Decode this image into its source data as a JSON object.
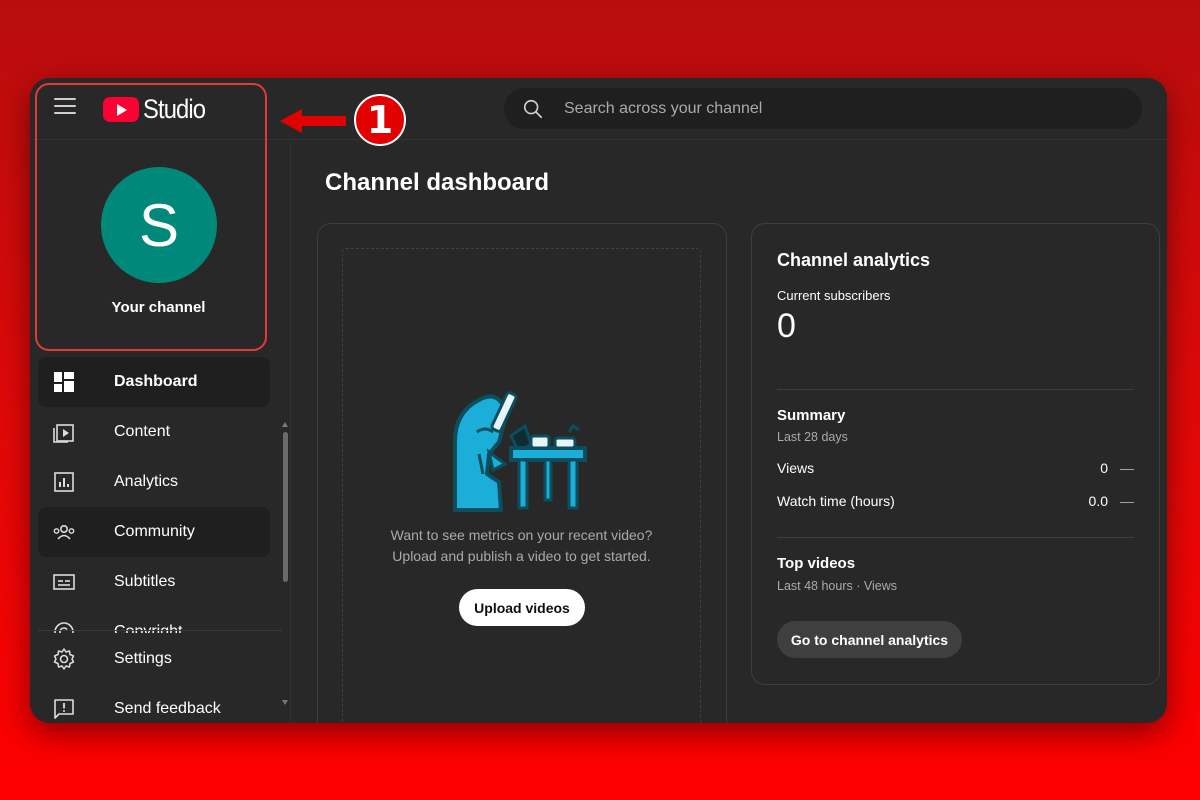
{
  "brand": {
    "logo_text": "Studio",
    "accent": "#ff0033"
  },
  "search": {
    "placeholder": "Search across your channel"
  },
  "channel": {
    "avatar_letter": "S",
    "avatar_color": "#00897b",
    "label": "Your channel"
  },
  "sidebar": {
    "items": [
      {
        "label": "Dashboard",
        "icon": "dashboard-icon",
        "state": "active"
      },
      {
        "label": "Content",
        "icon": "content-icon"
      },
      {
        "label": "Analytics",
        "icon": "analytics-icon"
      },
      {
        "label": "Community",
        "icon": "community-icon",
        "state": "hover"
      },
      {
        "label": "Subtitles",
        "icon": "subtitles-icon"
      },
      {
        "label": "Copyright",
        "icon": "copyright-icon"
      }
    ],
    "bottom": [
      {
        "label": "Settings",
        "icon": "gear-icon"
      },
      {
        "label": "Send feedback",
        "icon": "feedback-icon"
      }
    ]
  },
  "annotation": {
    "step": "1",
    "color": "#e53935"
  },
  "main": {
    "title": "Channel dashboard",
    "upload_card": {
      "prompt_line1": "Want to see metrics on your recent video?",
      "prompt_line2": "Upload and publish a video to get started.",
      "button": "Upload videos"
    },
    "analytics_card": {
      "title": "Channel analytics",
      "subs_label": "Current subscribers",
      "subs_value": "0",
      "summary_title": "Summary",
      "summary_period": "Last 28 days",
      "rows": [
        {
          "label": "Views",
          "value": "0",
          "trend": "—"
        },
        {
          "label": "Watch time (hours)",
          "value": "0.0",
          "trend": "—"
        }
      ],
      "top_title": "Top videos",
      "top_sub": "Last 48 hours · Views",
      "button": "Go to channel analytics"
    }
  }
}
